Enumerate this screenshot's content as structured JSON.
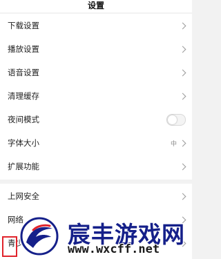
{
  "header": {
    "title": "设置"
  },
  "settings": {
    "items": [
      {
        "label": "下载设置"
      },
      {
        "label": "播放设置"
      },
      {
        "label": "语音设置"
      },
      {
        "label": "清理缓存"
      },
      {
        "label": "夜间模式",
        "toggle_on": false
      },
      {
        "label": "字体大小",
        "value": "中"
      },
      {
        "label": "扩展功能"
      }
    ],
    "items2": [
      {
        "label": "上网安全"
      },
      {
        "label": "网络"
      },
      {
        "label": "青少"
      }
    ]
  },
  "watermark": {
    "brand": "宸丰游戏网",
    "url": "www.wxcff.net"
  },
  "colors": {
    "highlight": "#e0232b",
    "watermark_blue": "#15208a"
  }
}
